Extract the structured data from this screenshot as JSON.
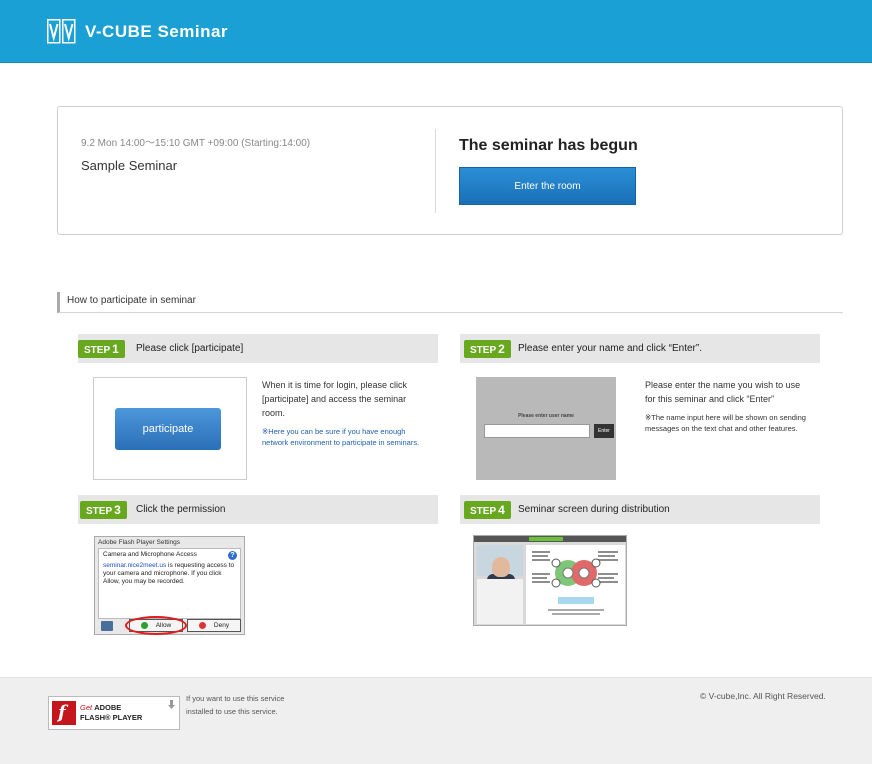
{
  "header": {
    "brand": "V-CUBE Seminar",
    "color": "#1ba0d5"
  },
  "seminar": {
    "time": "9.2 Mon 14:00〜15:10 GMT +09:00 (Starting:14:00)",
    "title": "Sample Seminar",
    "status": "The seminar has begun",
    "enter_label": "Enter the room"
  },
  "section": {
    "title": "How to participate in seminar"
  },
  "steps": [
    {
      "badge": "STEP",
      "number": "1",
      "title": "Please click [participate]",
      "button_label": "participate",
      "desc": "When it is time for login, please click [participate] and access the seminar room.",
      "note": "※Here you can be sure if you have enough network environment to participate in seminars."
    },
    {
      "badge": "STEP",
      "number": "2",
      "title": "Please enter your name and click “Enter”.",
      "mock_label": "Please enter user name",
      "mock_button": "Enter",
      "desc": "Please enter the name you wish to use for this seminar and click “Enter”",
      "note": "※The name input here will be shown on sending messages on the text chat and other features."
    },
    {
      "badge": "STEP",
      "number": "3",
      "title": "Click the permission",
      "dialog_title": "Adobe Flash Player Settings",
      "dialog_caption": "Camera and Microphone Access",
      "dialog_link": "seminar.nice2meet.us",
      "dialog_msg": " is requesting access to your camera and microphone. If you click Allow, you may be recorded.",
      "allow_label": "Allow",
      "deny_label": "Deny"
    },
    {
      "badge": "STEP",
      "number": "4",
      "title": "Seminar screen during distribution"
    }
  ],
  "footer": {
    "flash_get": "Get ",
    "flash_adobe": "ADOBE",
    "flash_player": "FLASH® PLAYER",
    "note_line1": "If you want to use this service",
    "note_line2": "installed to use this service.",
    "copyright": "© V-cube,Inc. All Right Reserved."
  },
  "colors": {
    "step_green": "#67a81f",
    "button_blue": "#1a6fb6"
  }
}
